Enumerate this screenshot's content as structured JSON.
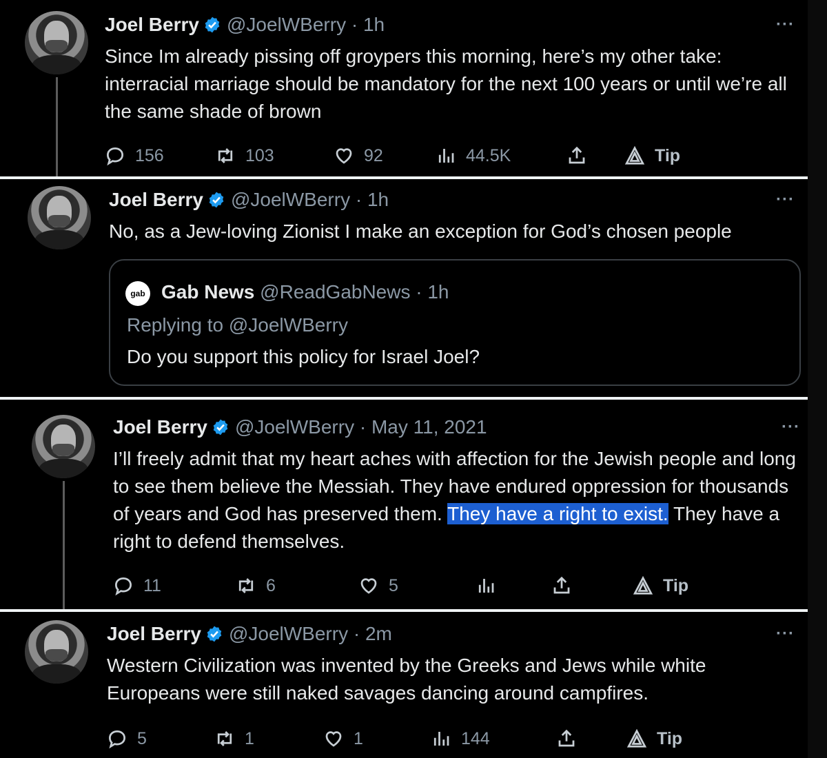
{
  "tweets": [
    {
      "name": "Joel Berry",
      "handle": "@JoelWBerry · 1h",
      "more": "···",
      "text": "Since Im already pissing off groypers this morning, here’s my other take: interracial marriage should be mandatory for the next 100 years or until we’re all the same shade of brown",
      "replies": "156",
      "retweets": "103",
      "likes": "92",
      "views": "44.5K",
      "tip": "Tip"
    },
    {
      "name": "Joel Berry",
      "handle": "@JoelWBerry · 1h",
      "more": "···",
      "text": "No, as a Jew-loving Zionist I make an exception for God’s chosen people",
      "quote": {
        "logo": "gab",
        "name": "Gab News",
        "handle": "@ReadGabNews · 1h",
        "reply": "Replying to @JoelWBerry",
        "text": "Do you support this policy for Israel Joel?"
      }
    },
    {
      "name": "Joel Berry",
      "handle": "@JoelWBerry · May 11, 2021",
      "more": "···",
      "text_before": "I’ll freely admit that my heart aches with affection for the Jewish people and long to see them believe the Messiah. They have endured oppression for thousands of years and God has preserved them. ",
      "text_highlight": "They have a right to exist.",
      "text_after": " They have a right to defend themselves.",
      "replies": "11",
      "retweets": "6",
      "likes": "5",
      "tip": "Tip"
    },
    {
      "name": "Joel Berry",
      "handle": "@JoelWBerry · 2m",
      "more": "···",
      "text": "Western Civilization was invented by the Greeks and Jews while white Europeans were still naked savages dancing around campfires.",
      "replies": "5",
      "retweets": "1",
      "likes": "1",
      "views": "144",
      "tip": "Tip"
    }
  ],
  "colors": {
    "background": "#000000",
    "text": "#e7e9ea",
    "muted": "#8b98a5",
    "verified": "#1d9bf0",
    "highlight": "#1d5fd1"
  }
}
